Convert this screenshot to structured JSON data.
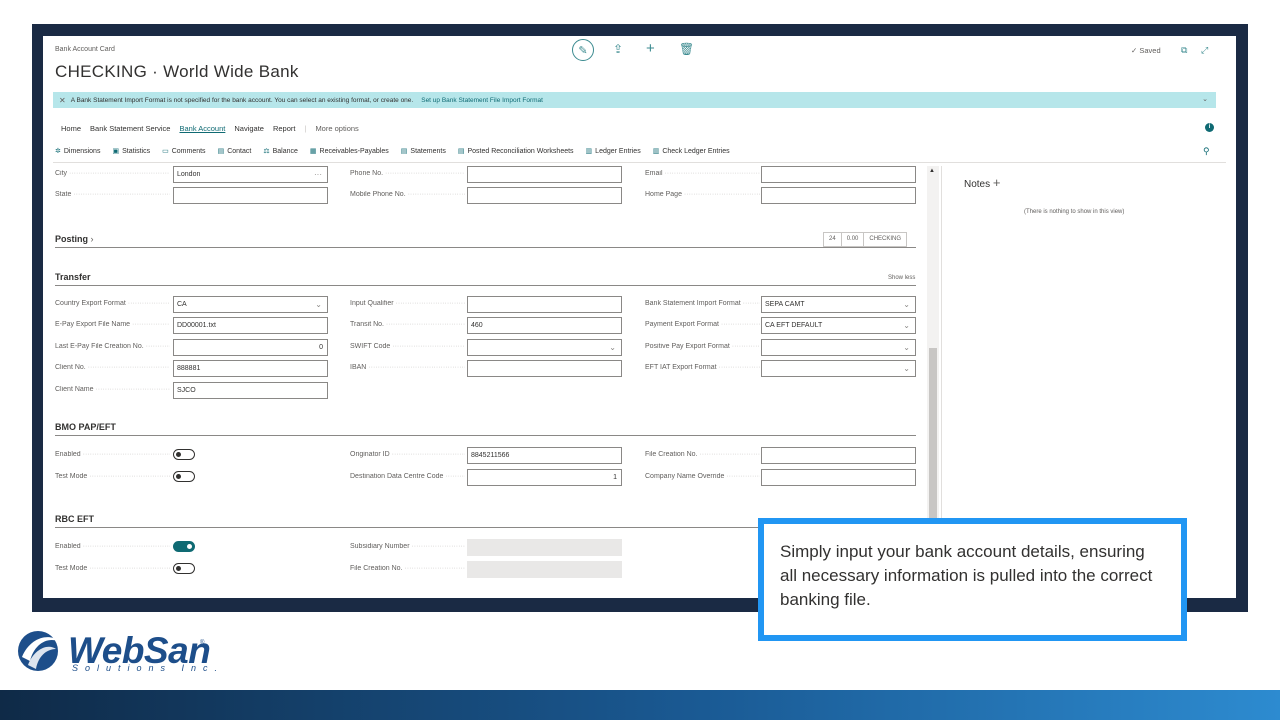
{
  "header": {
    "breadcrumb": "Bank Account Card",
    "title": "CHECKING · World Wide Bank",
    "saved_label": "Saved"
  },
  "banner": {
    "message": "A Bank Statement Import Format is not specified for the bank account. You can select an existing format, or create one.",
    "link": "Set up Bank Statement File Import Format"
  },
  "menu": {
    "items": [
      "Home",
      "Bank Statement Service",
      "Bank Account",
      "Navigate",
      "Report"
    ],
    "more": "More options"
  },
  "actions": [
    "Dimensions",
    "Statistics",
    "Comments",
    "Contact",
    "Balance",
    "Receivables-Payables",
    "Statements",
    "Posted Reconciliation Worksheets",
    "Ledger Entries",
    "Check Ledger Entries"
  ],
  "address": {
    "city_label": "City",
    "city_value": "London",
    "state_label": "State",
    "state_value": "",
    "phone_label": "Phone No.",
    "mobile_label": "Mobile Phone No.",
    "email_label": "Email",
    "home_page_label": "Home Page"
  },
  "posting": {
    "title": "Posting",
    "badge_1": "24",
    "badge_2": "0.00",
    "badge_3": "CHECKING"
  },
  "transfer": {
    "title": "Transfer",
    "show_less": "Show less",
    "country_export_format_label": "Country Export Format",
    "country_export_format_value": "CA",
    "epay_file_name_label": "E-Pay Export File Name",
    "epay_file_name_value": "DD00001.txt",
    "last_epay_label": "Last E-Pay File Creation No.",
    "last_epay_value": "0",
    "client_no_label": "Client No.",
    "client_no_value": "888881",
    "client_name_label": "Client Name",
    "client_name_value": "SJCO",
    "input_qualifier_label": "Input Qualifier",
    "input_qualifier_value": "",
    "transit_no_label": "Transit No.",
    "transit_no_value": "460",
    "swift_label": "SWIFT Code",
    "swift_value": "",
    "iban_label": "IBAN",
    "iban_value": "",
    "bs_import_format_label": "Bank Statement Import Format",
    "bs_import_format_value": "SEPA CAMT",
    "payment_export_format_label": "Payment Export Format",
    "payment_export_format_value": "CA EFT DEFAULT",
    "positive_pay_label": "Positive Pay Export Format",
    "positive_pay_value": "",
    "eft_iat_label": "EFT IAT Export Format",
    "eft_iat_value": ""
  },
  "bmo": {
    "title": "BMO PAP/EFT",
    "enabled_label": "Enabled",
    "enabled": false,
    "test_mode_label": "Test Mode",
    "test_mode": false,
    "originator_label": "Originator ID",
    "originator_value": "8845211566",
    "dest_label": "Destination Data Centre Code",
    "dest_value": "1",
    "file_creation_label": "File Creation No.",
    "file_creation_value": "",
    "company_override_label": "Company Name Override",
    "company_override_value": ""
  },
  "rbc": {
    "title": "RBC EFT",
    "enabled_label": "Enabled",
    "enabled": true,
    "test_mode_label": "Test Mode",
    "test_mode": false,
    "subsidiary_label": "Subsidiary Number",
    "subsidiary_value": "",
    "file_creation_label": "File Creation No.",
    "file_creation_value": ""
  },
  "notes": {
    "title": "Notes",
    "empty": "(There is nothing to show in this view)"
  },
  "callout": {
    "text": "Simply input your bank account details, ensuring all necessary information is pulled into the correct banking file."
  },
  "logo": {
    "name": "WebSan",
    "sub": "Solutions Inc.",
    "reg": "®"
  },
  "colors": {
    "accent": "#0f6a73",
    "banner": "#b6e6ea",
    "callout_border": "#2196f3",
    "brand": "#1d4e8a"
  }
}
